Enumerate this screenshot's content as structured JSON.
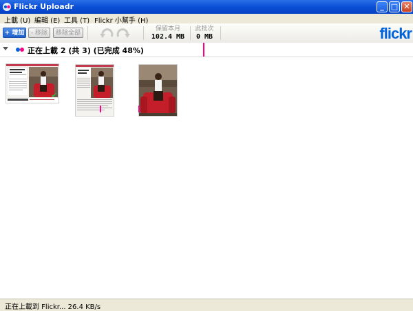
{
  "window": {
    "title": "Flickr Uploadr",
    "minimize_glyph": "_",
    "maximize_glyph": "□",
    "close_glyph": "✕"
  },
  "menu": {
    "items": [
      {
        "label": "上載 (U)"
      },
      {
        "label": "編輯 (E)"
      },
      {
        "label": "工具 (T)"
      },
      {
        "label": "Flickr 小幫手 (H)"
      }
    ]
  },
  "toolbar": {
    "add_label": "+ 增加",
    "remove_label": "- 移除",
    "remove_all_label": "移除全部",
    "remaining_label": "保留本月",
    "remaining_value": "102.4 MB",
    "batch_label": "此批次",
    "batch_value": "0 MB",
    "logo_text": "flickr"
  },
  "group": {
    "title": "正在上載 2 (共 3) (已完成 48%)",
    "progress_percent": 48
  },
  "thumbnails": [
    {
      "name": "photo-1",
      "status": "uploaded",
      "check": "✔"
    },
    {
      "name": "photo-2",
      "status": "uploading"
    },
    {
      "name": "photo-3",
      "status": "queued"
    }
  ],
  "status": {
    "text": "正在上載到 Flickr... 26.4 KB/s"
  },
  "colors": {
    "titlebar": "#0a4fd6",
    "flickr_blue": "#0063dc",
    "flickr_pink": "#ff0084"
  }
}
